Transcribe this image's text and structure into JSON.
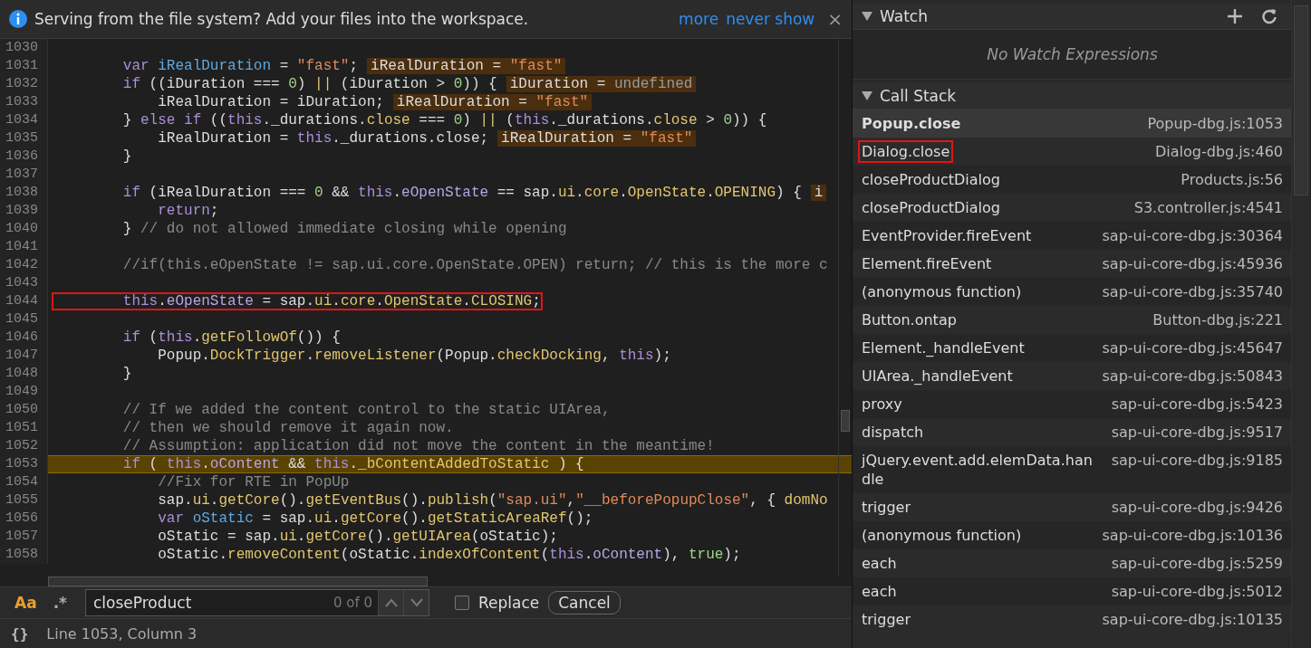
{
  "infobar": {
    "message": "Serving from the file system? Add your files into the workspace.",
    "links": [
      "more",
      "never show"
    ],
    "close": "×"
  },
  "editor": {
    "lines": [
      {
        "number": "1030",
        "current": false
      },
      {
        "number": "1031",
        "tokens": [
          {
            "text": "        var ",
            "kind": "k"
          },
          {
            "text": "iRealDuration",
            "kind": "v"
          },
          {
            "text": " = ",
            "kind": "t"
          },
          {
            "text": "\"fast\"",
            "kind": "s"
          },
          {
            "text": ";",
            "kind": "t"
          }
        ],
        "inline": [
          {
            "name": "iRealDuration",
            "operator": "=",
            "value": "\"fast\"",
            "kind": "s"
          }
        ],
        "current": false
      },
      {
        "number": "1032",
        "tokens": [
          {
            "text": "        if",
            "kind": "k"
          },
          {
            "text": " ((iDuration === ",
            "kind": "t"
          },
          {
            "text": "0",
            "kind": "n"
          },
          {
            "text": ") ",
            "kind": "t"
          },
          {
            "text": "||",
            "kind": "p"
          },
          {
            "text": " (iDuration > ",
            "kind": "t"
          },
          {
            "text": "0",
            "kind": "n"
          },
          {
            "text": ")) {",
            "kind": "t"
          }
        ],
        "inline": [
          {
            "name": "iDuration",
            "operator": "=",
            "value": "undefined",
            "kind": "u"
          }
        ],
        "current": false
      },
      {
        "number": "1033",
        "tokens": [
          {
            "text": "            iRealDuration = iDuration;",
            "kind": "t"
          }
        ],
        "inline": [
          {
            "name": "iRealDuration",
            "operator": "=",
            "value": "\"fast\"",
            "kind": "s"
          }
        ],
        "current": false
      },
      {
        "number": "1034",
        "tokens": [
          {
            "text": "        } ",
            "kind": "t"
          },
          {
            "text": "else if",
            "kind": "k"
          },
          {
            "text": " ((",
            "kind": "t"
          },
          {
            "text": "this",
            "kind": "k"
          },
          {
            "text": "._durations.",
            "kind": "t"
          },
          {
            "text": "close",
            "kind": "p"
          },
          {
            "text": " === ",
            "kind": "t"
          },
          {
            "text": "0",
            "kind": "n"
          },
          {
            "text": ") ",
            "kind": "t"
          },
          {
            "text": "||",
            "kind": "p"
          },
          {
            "text": " (",
            "kind": "t"
          },
          {
            "text": "this",
            "kind": "k"
          },
          {
            "text": "._durations.",
            "kind": "t"
          },
          {
            "text": "close",
            "kind": "p"
          },
          {
            "text": " > ",
            "kind": "t"
          },
          {
            "text": "0",
            "kind": "n"
          },
          {
            "text": ")) {",
            "kind": "t"
          }
        ],
        "current": false
      },
      {
        "number": "1035",
        "tokens": [
          {
            "text": "            iRealDuration = ",
            "kind": "t"
          },
          {
            "text": "this",
            "kind": "k"
          },
          {
            "text": "._durations.close;",
            "kind": "t"
          }
        ],
        "inline": [
          {
            "name": "iRealDuration",
            "operator": "=",
            "value": "\"fast\"",
            "kind": "s"
          }
        ],
        "current": false
      },
      {
        "number": "1036",
        "tokens": [
          {
            "text": "        }",
            "kind": "t"
          }
        ],
        "current": false
      },
      {
        "number": "1037",
        "current": false
      },
      {
        "number": "1038",
        "tokens": [
          {
            "text": "        if",
            "kind": "k"
          },
          {
            "text": " (iRealDuration === ",
            "kind": "t"
          },
          {
            "text": "0",
            "kind": "n"
          },
          {
            "text": " && ",
            "kind": "t"
          },
          {
            "text": "this",
            "kind": "k"
          },
          {
            "text": ".",
            "kind": "t"
          },
          {
            "text": "eOpenState",
            "kind": "m"
          },
          {
            "text": " == sap.",
            "kind": "t"
          },
          {
            "text": "ui",
            "kind": "p"
          },
          {
            "text": ".",
            "kind": "t"
          },
          {
            "text": "core",
            "kind": "p"
          },
          {
            "text": ".",
            "kind": "t"
          },
          {
            "text": "OpenState",
            "kind": "p"
          },
          {
            "text": ".",
            "kind": "t"
          },
          {
            "text": "OPENING",
            "kind": "p"
          },
          {
            "text": ") {",
            "kind": "t"
          }
        ],
        "inline": [
          {
            "name": "i"
          }
        ],
        "current": false
      },
      {
        "number": "1039",
        "tokens": [
          {
            "text": "            return",
            "kind": "k"
          },
          {
            "text": ";",
            "kind": "t"
          }
        ],
        "current": false
      },
      {
        "number": "1040",
        "tokens": [
          {
            "text": "        } ",
            "kind": "t"
          },
          {
            "text": "// do not allowed immediate closing while opening",
            "kind": "c"
          }
        ],
        "current": false
      },
      {
        "number": "1041",
        "current": false
      },
      {
        "number": "1042",
        "tokens": [
          {
            "text": "        //if(this.eOpenState != sap.ui.core.OpenState.OPEN) return; // this is the more c",
            "kind": "c"
          }
        ],
        "current": false
      },
      {
        "number": "1043",
        "current": false
      },
      {
        "number": "1044",
        "tokens": [
          {
            "text": "        this",
            "kind": "k"
          },
          {
            "text": ".",
            "kind": "t"
          },
          {
            "text": "eOpenState",
            "kind": "m"
          },
          {
            "text": " = sap.",
            "kind": "t"
          },
          {
            "text": "ui",
            "kind": "p"
          },
          {
            "text": ".",
            "kind": "t"
          },
          {
            "text": "core",
            "kind": "p"
          },
          {
            "text": ".",
            "kind": "t"
          },
          {
            "text": "OpenState",
            "kind": "p"
          },
          {
            "text": ".",
            "kind": "t"
          },
          {
            "text": "CLOSING",
            "kind": "p"
          },
          {
            "text": ";",
            "kind": "t"
          }
        ],
        "current": false,
        "boxed": true
      },
      {
        "number": "1045",
        "current": false
      },
      {
        "number": "1046",
        "tokens": [
          {
            "text": "        if",
            "kind": "k"
          },
          {
            "text": " (",
            "kind": "t"
          },
          {
            "text": "this",
            "kind": "k"
          },
          {
            "text": ".",
            "kind": "t"
          },
          {
            "text": "getFollowOf",
            "kind": "p"
          },
          {
            "text": "()) {",
            "kind": "t"
          }
        ],
        "current": false
      },
      {
        "number": "1047",
        "tokens": [
          {
            "text": "            Popup.",
            "kind": "t"
          },
          {
            "text": "DockTrigger",
            "kind": "p"
          },
          {
            "text": ".",
            "kind": "t"
          },
          {
            "text": "removeListener",
            "kind": "p"
          },
          {
            "text": "(Popup.",
            "kind": "t"
          },
          {
            "text": "checkDocking",
            "kind": "p"
          },
          {
            "text": ", ",
            "kind": "t"
          },
          {
            "text": "this",
            "kind": "k"
          },
          {
            "text": ");",
            "kind": "t"
          }
        ],
        "current": false
      },
      {
        "number": "1048",
        "tokens": [
          {
            "text": "        }",
            "kind": "t"
          }
        ],
        "current": false
      },
      {
        "number": "1049",
        "current": false
      },
      {
        "number": "1050",
        "tokens": [
          {
            "text": "        // If we added the content control to the static UIArea,",
            "kind": "c"
          }
        ],
        "current": false
      },
      {
        "number": "1051",
        "tokens": [
          {
            "text": "        // then we should remove it again now.",
            "kind": "c"
          }
        ],
        "current": false
      },
      {
        "number": "1052",
        "tokens": [
          {
            "text": "        // Assumption: application did not move the content in the meantime!",
            "kind": "c"
          }
        ],
        "current": false
      },
      {
        "number": "1053",
        "tokens": [
          {
            "text": "        if",
            "kind": "k"
          },
          {
            "text": " ( ",
            "kind": "t"
          },
          {
            "text": "this",
            "kind": "k"
          },
          {
            "text": ".",
            "kind": "t"
          },
          {
            "text": "oContent",
            "kind": "m"
          },
          {
            "text": " && ",
            "kind": "t"
          },
          {
            "text": "this",
            "kind": "k"
          },
          {
            "text": ".",
            "kind": "t"
          },
          {
            "text": "_bContentAddedToStatic",
            "kind": "p"
          },
          {
            "text": " ) {",
            "kind": "t"
          }
        ],
        "current": true
      },
      {
        "number": "1054",
        "tokens": [
          {
            "text": "            //Fix for RTE in PopUp",
            "kind": "c"
          }
        ],
        "current": false
      },
      {
        "number": "1055",
        "tokens": [
          {
            "text": "            sap.",
            "kind": "t"
          },
          {
            "text": "ui",
            "kind": "p"
          },
          {
            "text": ".",
            "kind": "t"
          },
          {
            "text": "getCore",
            "kind": "p"
          },
          {
            "text": "().",
            "kind": "t"
          },
          {
            "text": "getEventBus",
            "kind": "p"
          },
          {
            "text": "().",
            "kind": "t"
          },
          {
            "text": "publish",
            "kind": "p"
          },
          {
            "text": "(",
            "kind": "t"
          },
          {
            "text": "\"sap.ui\"",
            "kind": "s"
          },
          {
            "text": ",",
            "kind": "t"
          },
          {
            "text": "\"__beforePopupClose\"",
            "kind": "s"
          },
          {
            "text": ", { ",
            "kind": "t"
          },
          {
            "text": "domNo",
            "kind": "p"
          }
        ],
        "current": false
      },
      {
        "number": "1056",
        "tokens": [
          {
            "text": "            var ",
            "kind": "k"
          },
          {
            "text": "oStatic",
            "kind": "v"
          },
          {
            "text": " = sap.",
            "kind": "t"
          },
          {
            "text": "ui",
            "kind": "p"
          },
          {
            "text": ".",
            "kind": "t"
          },
          {
            "text": "getCore",
            "kind": "p"
          },
          {
            "text": "().",
            "kind": "t"
          },
          {
            "text": "getStaticAreaRef",
            "kind": "p"
          },
          {
            "text": "();",
            "kind": "t"
          }
        ],
        "current": false
      },
      {
        "number": "1057",
        "tokens": [
          {
            "text": "            oStatic = sap.",
            "kind": "t"
          },
          {
            "text": "ui",
            "kind": "p"
          },
          {
            "text": ".",
            "kind": "t"
          },
          {
            "text": "getCore",
            "kind": "p"
          },
          {
            "text": "().",
            "kind": "t"
          },
          {
            "text": "getUIArea",
            "kind": "p"
          },
          {
            "text": "(oStatic);",
            "kind": "t"
          }
        ],
        "current": false
      },
      {
        "number": "1058",
        "tokens": [
          {
            "text": "            oStatic.",
            "kind": "t"
          },
          {
            "text": "removeContent",
            "kind": "p"
          },
          {
            "text": "(oStatic.",
            "kind": "t"
          },
          {
            "text": "indexOfContent",
            "kind": "p"
          },
          {
            "text": "(",
            "kind": "t"
          },
          {
            "text": "this",
            "kind": "k"
          },
          {
            "text": ".",
            "kind": "t"
          },
          {
            "text": "oContent",
            "kind": "m"
          },
          {
            "text": "), ",
            "kind": "t"
          },
          {
            "text": "true",
            "kind": "n"
          },
          {
            "text": ");",
            "kind": "t"
          }
        ],
        "current": false
      }
    ]
  },
  "search": {
    "case_toggle": {
      "label": "Aa",
      "on": true
    },
    "regex_toggle": {
      "label": ".*",
      "on": false
    },
    "query": "closeProduct",
    "count": "0 of 0",
    "replace": {
      "label": "Replace",
      "checked": false
    },
    "cancel": "Cancel"
  },
  "status_bar": {
    "braces": "{}",
    "position": "Line 1053, Column 3"
  },
  "watch": {
    "title": "Watch",
    "expanded": true,
    "empty_text": "No Watch Expressions"
  },
  "call_stack": {
    "title": "Call Stack",
    "expanded": true,
    "frames": [
      {
        "name": "Popup.close",
        "location": "Popup-dbg.js:1053",
        "selected": true,
        "boxed": false
      },
      {
        "name": "Dialog.close",
        "location": "Dialog-dbg.js:460",
        "selected": false,
        "boxed": true
      },
      {
        "name": "closeProductDialog",
        "location": "Products.js:56",
        "selected": false,
        "boxed": false
      },
      {
        "name": "closeProductDialog",
        "location": "S3.controller.js:4541",
        "selected": false,
        "boxed": false
      },
      {
        "name": "EventProvider.fireEvent",
        "location": "sap-ui-core-dbg.js:30364",
        "selected": false,
        "boxed": false
      },
      {
        "name": "Element.fireEvent",
        "location": "sap-ui-core-dbg.js:45936",
        "selected": false,
        "boxed": false
      },
      {
        "name": "(anonymous function)",
        "location": "sap-ui-core-dbg.js:35740",
        "selected": false,
        "boxed": false
      },
      {
        "name": "Button.ontap",
        "location": "Button-dbg.js:221",
        "selected": false,
        "boxed": false
      },
      {
        "name": "Element._handleEvent",
        "location": "sap-ui-core-dbg.js:45647",
        "selected": false,
        "boxed": false
      },
      {
        "name": "UIArea._handleEvent",
        "location": "sap-ui-core-dbg.js:50843",
        "selected": false,
        "boxed": false
      },
      {
        "name": "proxy",
        "location": "sap-ui-core-dbg.js:5423",
        "selected": false,
        "boxed": false
      },
      {
        "name": "dispatch",
        "location": "sap-ui-core-dbg.js:9517",
        "selected": false,
        "boxed": false
      },
      {
        "name": "jQuery.event.add.elemData.handle",
        "location": "sap-ui-core-dbg.js:9185",
        "selected": false,
        "boxed": false
      },
      {
        "name": "trigger",
        "location": "sap-ui-core-dbg.js:9426",
        "selected": false,
        "boxed": false
      },
      {
        "name": "(anonymous function)",
        "location": "sap-ui-core-dbg.js:10136",
        "selected": false,
        "boxed": false
      },
      {
        "name": "each",
        "location": "sap-ui-core-dbg.js:5259",
        "selected": false,
        "boxed": false
      },
      {
        "name": "each",
        "location": "sap-ui-core-dbg.js:5012",
        "selected": false,
        "boxed": false
      },
      {
        "name": "trigger",
        "location": "sap-ui-core-dbg.js:10135",
        "selected": false,
        "boxed": false
      }
    ]
  }
}
